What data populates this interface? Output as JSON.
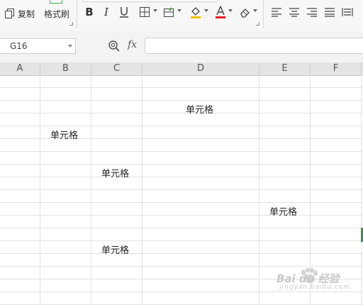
{
  "toolbar": {
    "copy_label": "复制",
    "format_painter_label": "格式刷",
    "font_color_accent": "#e02020",
    "fill_color_accent": "#f2c200",
    "painter_accent": "#4caf50"
  },
  "formula_bar": {
    "name_box_value": "G16",
    "fx_label": "fx",
    "formula_value": ""
  },
  "columns": [
    "A",
    "B",
    "C",
    "D",
    "E",
    "F"
  ],
  "cells": [
    {
      "ref": "D3",
      "value": "单元格"
    },
    {
      "ref": "B5",
      "value": "单元格"
    },
    {
      "ref": "C8",
      "value": "单元格"
    },
    {
      "ref": "E11",
      "value": "单元格"
    },
    {
      "ref": "C14",
      "value": "单元格"
    }
  ],
  "watermark": {
    "line1": "Bai du 经验",
    "line2": "jingyan.baidu.com"
  }
}
